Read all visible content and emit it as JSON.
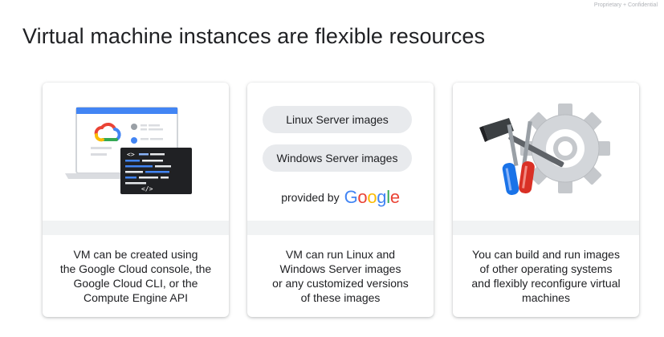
{
  "header": {
    "confidential_label": "Proprietary + Confidential",
    "title": "Virtual machine instances are flexible resources"
  },
  "cards": [
    {
      "illustration": "laptop-with-console-and-terminal",
      "caption_lines": [
        "VM can be created using",
        "the Google Cloud console, the",
        "Google Cloud CLI, or the",
        "Compute Engine API"
      ]
    },
    {
      "pills": [
        "Linux Server images",
        "Windows Server images"
      ],
      "provided_by": "provided by",
      "google_letters": [
        {
          "ch": "G",
          "color": "#4285F4"
        },
        {
          "ch": "o",
          "color": "#EA4335"
        },
        {
          "ch": "o",
          "color": "#FBBC05"
        },
        {
          "ch": "g",
          "color": "#4285F4"
        },
        {
          "ch": "l",
          "color": "#34A853"
        },
        {
          "ch": "e",
          "color": "#EA4335"
        }
      ],
      "caption_lines": [
        "VM can run Linux and",
        "Windows Server images",
        "or any customized versions",
        "of these images"
      ]
    },
    {
      "illustration": "gear-with-hammer-and-screwdrivers",
      "caption_lines": [
        "You can build and run images",
        "of other operating systems",
        "and flexibly reconfigure virtual",
        "machines"
      ]
    }
  ],
  "colors": {
    "blue": "#4285F4",
    "red": "#EA4335",
    "yellow": "#FBBC05",
    "green": "#34A853",
    "terminal": "#202124",
    "card_band": "#f1f3f4",
    "pill": "#e8eaed"
  }
}
